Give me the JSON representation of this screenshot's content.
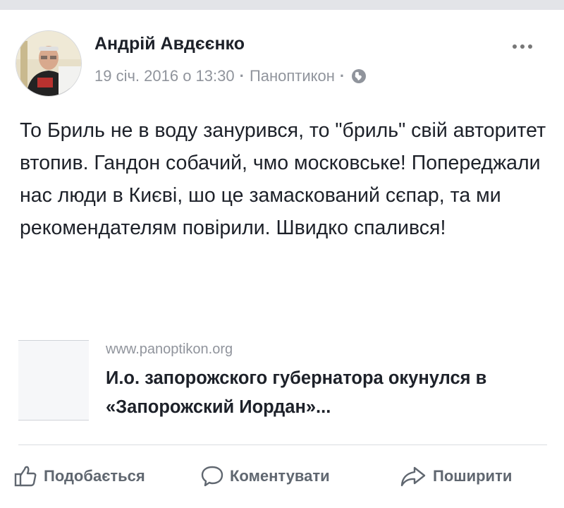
{
  "post": {
    "author": "Андрій Авдєєнко",
    "date": "19 січ. 2016 о 13:30",
    "separator": "·",
    "page": "Паноптикон",
    "privacy_icon": "globe-icon",
    "more_icon": "more-options-icon",
    "text": "То Бриль не в воду занурився, то \"бриль\" свій авторитет втопив. Гандон собачий, чмо московське! Попереджали нас люди в Києві, шо це замаскований сєпар, та ми рекомендателям повірили. Швидко спалився!"
  },
  "link_preview": {
    "domain": "www.panoptikon.org",
    "title": "И.о. запорожского губернатора окунулся в «Запорожский Иордан»..."
  },
  "actions": {
    "like": "Подобається",
    "comment": "Коментувати",
    "share": "Поширити"
  },
  "colors": {
    "text": "#1d2129",
    "secondary_text": "#90949c",
    "action_text": "#606770",
    "divider": "#dadde1"
  }
}
